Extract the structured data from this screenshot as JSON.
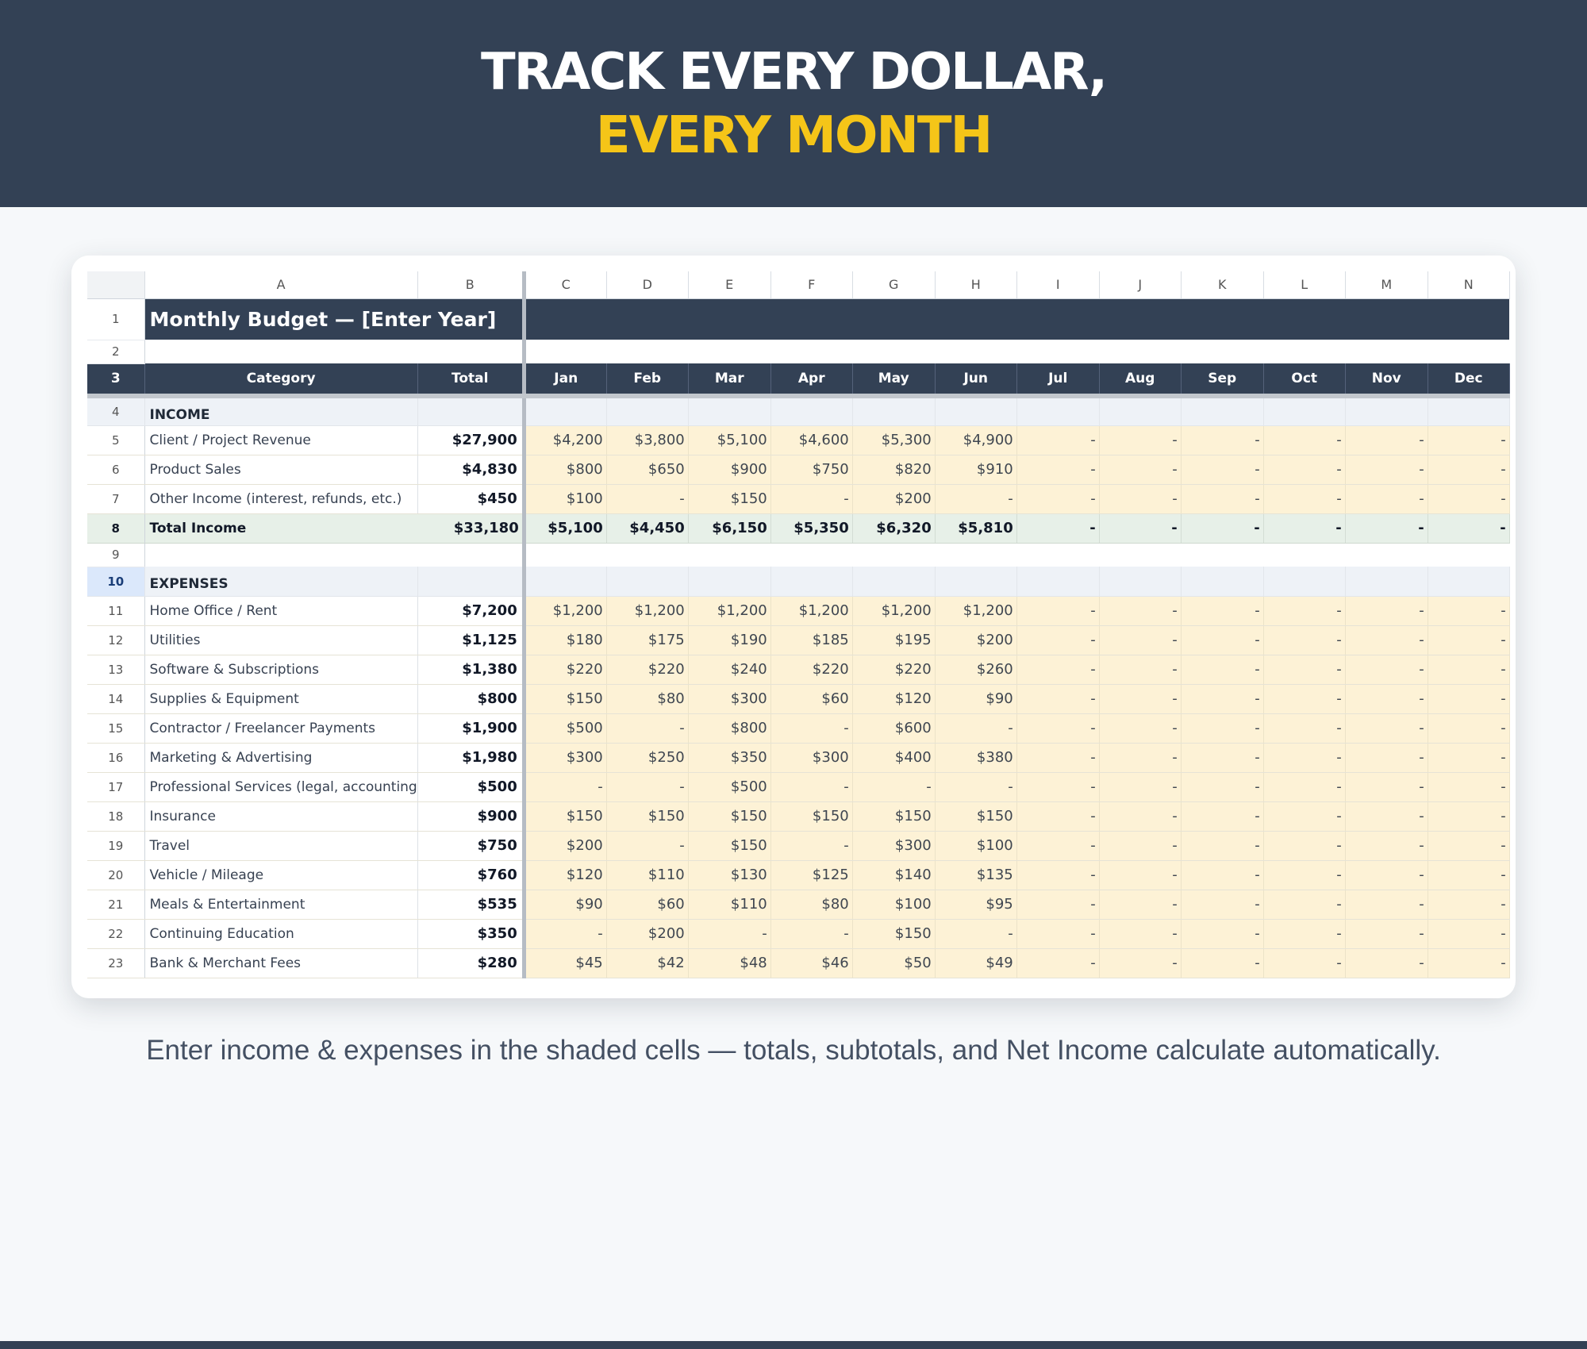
{
  "hero": {
    "line1": "TRACK EVERY DOLLAR,",
    "line2": "EVERY MONTH",
    "accent_color": "#f5c518",
    "bg_color": "#334155"
  },
  "sheet": {
    "columns": [
      "A",
      "B",
      "C",
      "D",
      "E",
      "F",
      "G",
      "H",
      "I",
      "J",
      "K",
      "L",
      "M",
      "N"
    ],
    "title": "Monthly Budget — [Enter Year]",
    "header": {
      "category": "Category",
      "total": "Total",
      "months": [
        "Jan",
        "Feb",
        "Mar",
        "Apr",
        "May",
        "Jun",
        "Jul",
        "Aug",
        "Sep",
        "Oct",
        "Nov",
        "Dec"
      ]
    },
    "rows": [
      {
        "num": "1",
        "type": "title"
      },
      {
        "num": "2",
        "type": "blank"
      },
      {
        "num": "3",
        "type": "header"
      },
      {
        "num": "4",
        "type": "section",
        "label": "INCOME"
      },
      {
        "num": "5",
        "type": "item",
        "label": "Client / Project Revenue",
        "total": "$27,900",
        "months": [
          "$4,200",
          "$3,800",
          "$5,100",
          "$4,600",
          "$5,300",
          "$4,900",
          "-",
          "-",
          "-",
          "-",
          "-",
          "-"
        ]
      },
      {
        "num": "6",
        "type": "item",
        "label": "Product Sales",
        "total": "$4,830",
        "months": [
          "$800",
          "$650",
          "$900",
          "$750",
          "$820",
          "$910",
          "-",
          "-",
          "-",
          "-",
          "-",
          "-"
        ]
      },
      {
        "num": "7",
        "type": "item",
        "label": "Other Income (interest, refunds, etc.)",
        "total": "$450",
        "months": [
          "$100",
          "-",
          "$150",
          "-",
          "$200",
          "-",
          "-",
          "-",
          "-",
          "-",
          "-",
          "-"
        ]
      },
      {
        "num": "8",
        "type": "total",
        "label": "Total Income",
        "total": "$33,180",
        "months": [
          "$5,100",
          "$4,450",
          "$6,150",
          "$5,350",
          "$6,320",
          "$5,810",
          "-",
          "-",
          "-",
          "-",
          "-",
          "-"
        ]
      },
      {
        "num": "9",
        "type": "blank"
      },
      {
        "num": "10",
        "type": "section",
        "label": "EXPENSES",
        "active": true
      },
      {
        "num": "11",
        "type": "item",
        "label": "Home Office / Rent",
        "total": "$7,200",
        "months": [
          "$1,200",
          "$1,200",
          "$1,200",
          "$1,200",
          "$1,200",
          "$1,200",
          "-",
          "-",
          "-",
          "-",
          "-",
          "-"
        ]
      },
      {
        "num": "12",
        "type": "item",
        "label": "Utilities",
        "total": "$1,125",
        "months": [
          "$180",
          "$175",
          "$190",
          "$185",
          "$195",
          "$200",
          "-",
          "-",
          "-",
          "-",
          "-",
          "-"
        ]
      },
      {
        "num": "13",
        "type": "item",
        "label": "Software & Subscriptions",
        "total": "$1,380",
        "months": [
          "$220",
          "$220",
          "$240",
          "$220",
          "$220",
          "$260",
          "-",
          "-",
          "-",
          "-",
          "-",
          "-"
        ]
      },
      {
        "num": "14",
        "type": "item",
        "label": "Supplies & Equipment",
        "total": "$800",
        "months": [
          "$150",
          "$80",
          "$300",
          "$60",
          "$120",
          "$90",
          "-",
          "-",
          "-",
          "-",
          "-",
          "-"
        ]
      },
      {
        "num": "15",
        "type": "item",
        "label": "Contractor / Freelancer Payments",
        "total": "$1,900",
        "months": [
          "$500",
          "-",
          "$800",
          "-",
          "$600",
          "-",
          "-",
          "-",
          "-",
          "-",
          "-",
          "-"
        ]
      },
      {
        "num": "16",
        "type": "item",
        "label": "Marketing & Advertising",
        "total": "$1,980",
        "months": [
          "$300",
          "$250",
          "$350",
          "$300",
          "$400",
          "$380",
          "-",
          "-",
          "-",
          "-",
          "-",
          "-"
        ]
      },
      {
        "num": "17",
        "type": "item",
        "label": "Professional Services (legal, accounting",
        "total": "$500",
        "months": [
          "-",
          "-",
          "$500",
          "-",
          "-",
          "-",
          "-",
          "-",
          "-",
          "-",
          "-",
          "-"
        ]
      },
      {
        "num": "18",
        "type": "item",
        "label": "Insurance",
        "total": "$900",
        "months": [
          "$150",
          "$150",
          "$150",
          "$150",
          "$150",
          "$150",
          "-",
          "-",
          "-",
          "-",
          "-",
          "-"
        ]
      },
      {
        "num": "19",
        "type": "item",
        "label": "Travel",
        "total": "$750",
        "months": [
          "$200",
          "-",
          "$150",
          "-",
          "$300",
          "$100",
          "-",
          "-",
          "-",
          "-",
          "-",
          "-"
        ]
      },
      {
        "num": "20",
        "type": "item",
        "label": "Vehicle / Mileage",
        "total": "$760",
        "months": [
          "$120",
          "$110",
          "$130",
          "$125",
          "$140",
          "$135",
          "-",
          "-",
          "-",
          "-",
          "-",
          "-"
        ]
      },
      {
        "num": "21",
        "type": "item",
        "label": "Meals & Entertainment",
        "total": "$535",
        "months": [
          "$90",
          "$60",
          "$110",
          "$80",
          "$100",
          "$95",
          "-",
          "-",
          "-",
          "-",
          "-",
          "-"
        ]
      },
      {
        "num": "22",
        "type": "item",
        "label": "Continuing Education",
        "total": "$350",
        "months": [
          "-",
          "$200",
          "-",
          "-",
          "$150",
          "-",
          "-",
          "-",
          "-",
          "-",
          "-",
          "-"
        ]
      },
      {
        "num": "23",
        "type": "item",
        "label": "Bank & Merchant Fees",
        "total": "$280",
        "months": [
          "$45",
          "$42",
          "$48",
          "$46",
          "$50",
          "$49",
          "-",
          "-",
          "-",
          "-",
          "-",
          "-"
        ]
      }
    ]
  },
  "caption": "Enter income & expenses in the shaded cells — totals, subtotals, and Net Income calculate automatically."
}
